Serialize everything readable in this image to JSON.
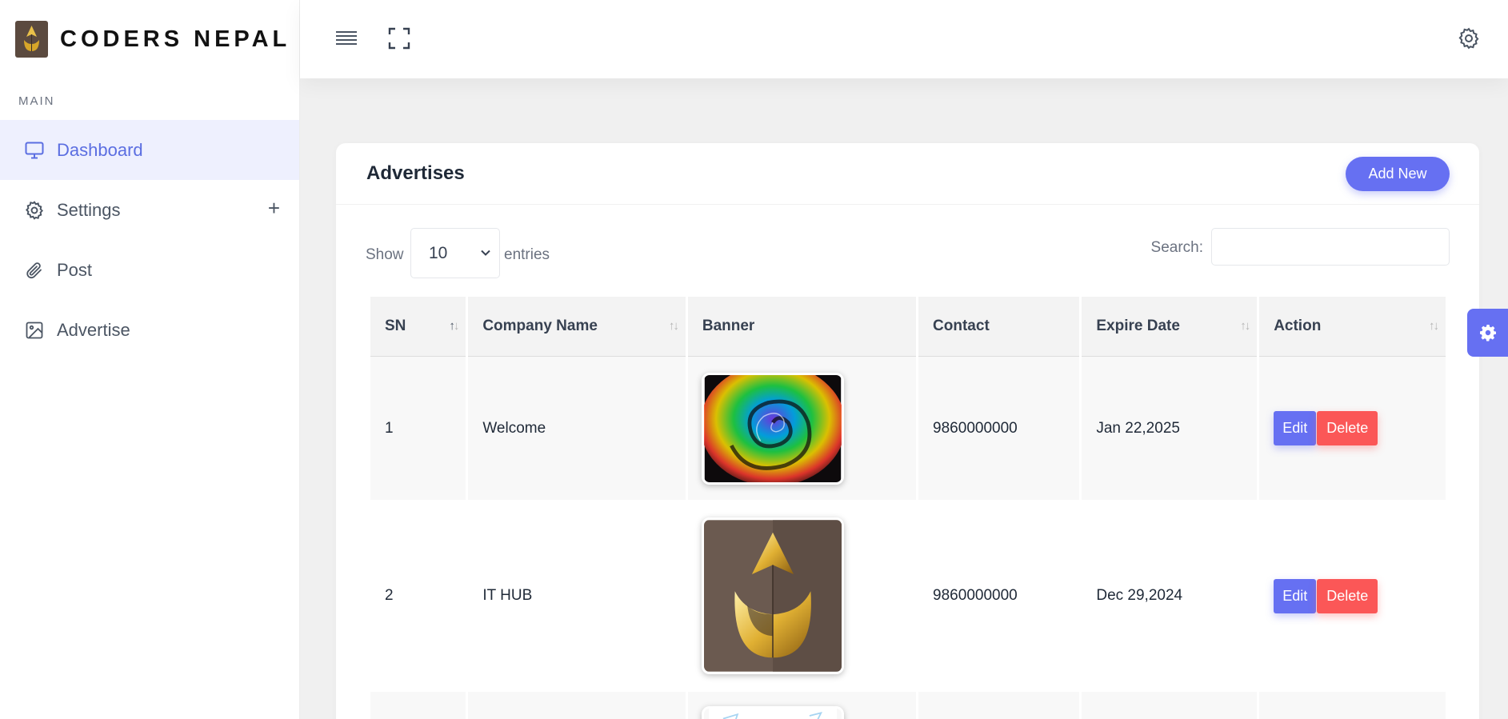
{
  "brand": {
    "name": "CODERS NEPAL"
  },
  "sidebar": {
    "section_title": "MAIN",
    "items": [
      {
        "label": "Dashboard",
        "icon": "monitor-icon",
        "active": true
      },
      {
        "label": "Settings",
        "icon": "gear-icon",
        "expand": "+"
      },
      {
        "label": "Post",
        "icon": "paperclip-icon"
      },
      {
        "label": "Advertise",
        "icon": "image-icon"
      }
    ]
  },
  "topbar": {
    "menu_icon": "hamburger-icon",
    "fullscreen_icon": "fullscreen-icon",
    "settings_icon": "gear-icon"
  },
  "card": {
    "title": "Advertises",
    "add_button": "Add New"
  },
  "controls": {
    "show_label": "Show",
    "entries_value": "10",
    "entries_label": "entries",
    "search_label": "Search:",
    "search_value": ""
  },
  "table": {
    "columns": [
      "SN",
      "Company Name",
      "Banner",
      "Contact",
      "Expire Date",
      "Action"
    ],
    "rows": [
      {
        "sn": "1",
        "company": "Welcome",
        "banner": "spiral-banner",
        "contact": "9860000000",
        "expire": "Jan 22,2025",
        "edit": "Edit",
        "delete": "Delete"
      },
      {
        "sn": "2",
        "company": "IT HUB",
        "banner": "gold-logo-banner",
        "contact": "9860000000",
        "expire": "Dec 29,2024",
        "edit": "Edit",
        "delete": "Delete"
      }
    ]
  },
  "colors": {
    "accent": "#6670f2",
    "danger": "#fb5757",
    "active_bg": "#eef0fe",
    "active_text": "#5b6ee1"
  }
}
